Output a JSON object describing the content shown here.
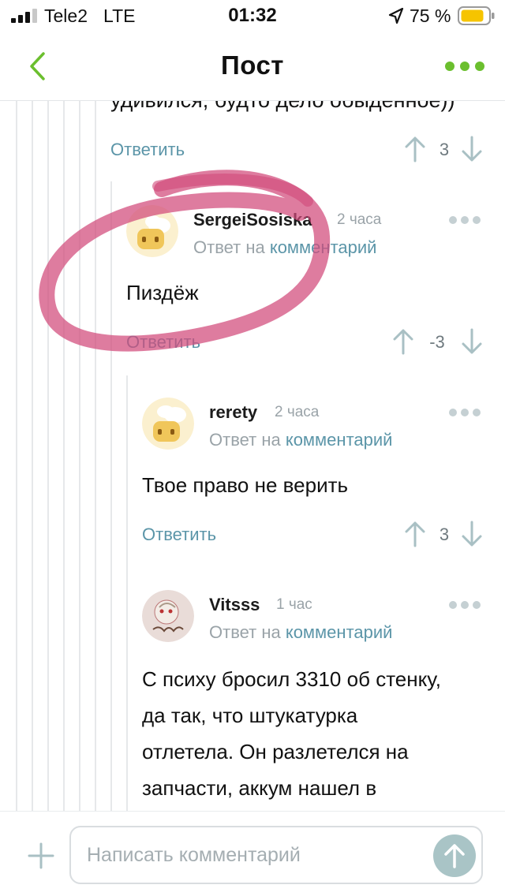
{
  "status_bar": {
    "carrier": "Tele2",
    "network": "LTE",
    "time": "01:32",
    "battery_percent": "75 %",
    "icons": [
      "signal-icon",
      "location-arrow-icon",
      "battery-icon"
    ]
  },
  "nav": {
    "title": "Пост",
    "back_icon": "chevron-left-icon",
    "more_icon": "more-dots-icon",
    "accent_color": "#6bbf2e"
  },
  "previous_comment": {
    "cut_text": "удивился, будто дело обыденное))",
    "reply_label": "Ответить",
    "rating": "3"
  },
  "comments": [
    {
      "author": "SergeiSosiska",
      "time": "2 часа",
      "reply_prefix": "Ответ на ",
      "reply_link": "комментарий",
      "body": "Пиздёж",
      "reply_label": "Ответить",
      "rating": "-3"
    },
    {
      "author": "rerety",
      "time": "2 часа",
      "reply_prefix": "Ответ на ",
      "reply_link": "комментарий",
      "body": "Твое право не верить",
      "reply_label": "Ответить",
      "rating": "3"
    },
    {
      "author": "Vitsss",
      "time": "1 час",
      "reply_prefix": "Ответ на ",
      "reply_link": "комментарий",
      "body_lines": [
        "С психу бросил 3310 об стенку,",
        "да так, что штукатурка",
        "отлетела. Он разлетелся на",
        "запчасти, аккум нашел в"
      ]
    }
  ],
  "bottom_bar": {
    "input_placeholder": "Написать комментарий",
    "plus_icon": "plus-icon",
    "send_icon": "arrow-up-icon"
  },
  "colors": {
    "link": "#5b95a8",
    "muted": "#9aa3a8",
    "highlight": "#d14a7a"
  }
}
